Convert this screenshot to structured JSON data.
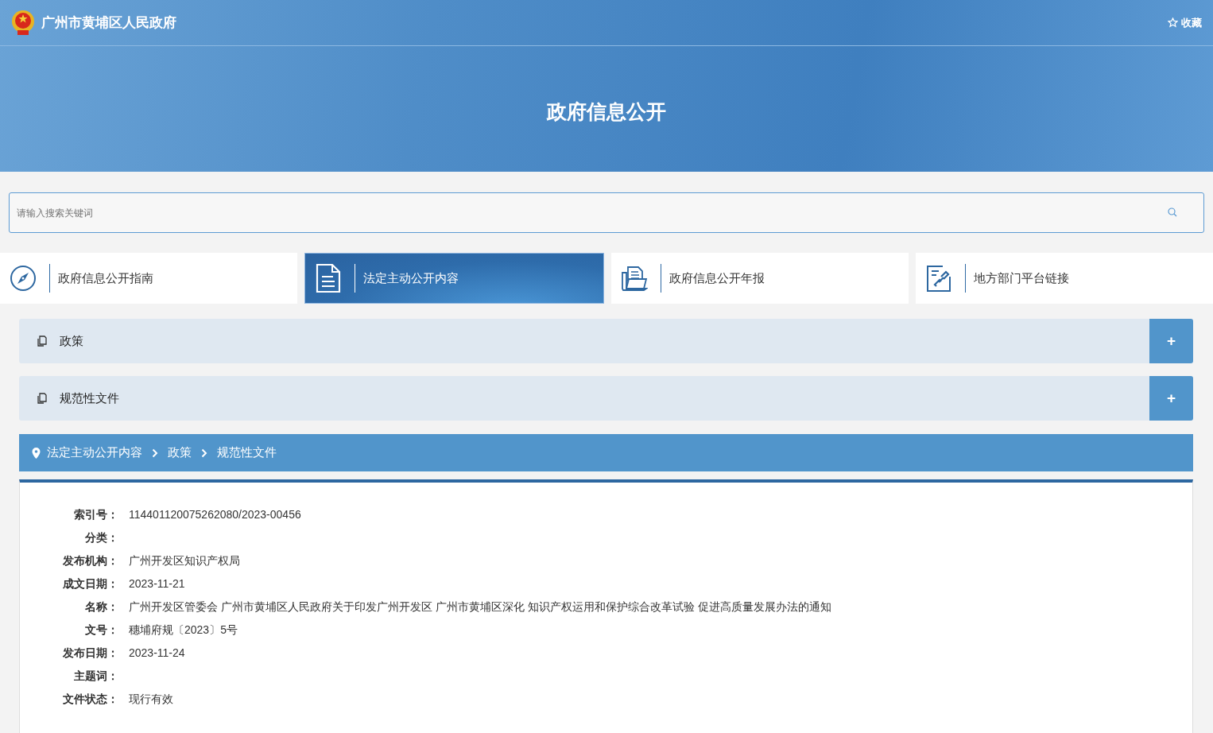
{
  "header": {
    "site_title": "广州市黄埔区人民政府",
    "favorite": "收藏",
    "banner_title": "政府信息公开"
  },
  "search": {
    "placeholder": "请输入搜索关键词"
  },
  "tabs": [
    {
      "label": "政府信息公开指南",
      "selected": false
    },
    {
      "label": "法定主动公开内容",
      "selected": true
    },
    {
      "label": "政府信息公开年报",
      "selected": false
    },
    {
      "label": "地方部门平台链接",
      "selected": false
    }
  ],
  "sections": [
    {
      "title": "政策",
      "toggle": "+"
    },
    {
      "title": "规范性文件",
      "toggle": "+"
    }
  ],
  "breadcrumb": [
    "法定主动公开内容",
    "政策",
    "规范性文件"
  ],
  "details": [
    {
      "label": "索引号：",
      "value": "114401120075262080/2023-00456"
    },
    {
      "label": "分类："
    },
    {
      "label": "发布机构：",
      "value": "广州开发区知识产权局"
    },
    {
      "label": "成文日期：",
      "value": "2023-11-21"
    },
    {
      "label": "名称：",
      "value": "广州开发区管委会 广州市黄埔区人民政府关于印发广州开发区 广州市黄埔区深化 知识产权运用和保护综合改革试验 促进高质量发展办法的通知"
    },
    {
      "label": "文号：",
      "value": "穗埔府规〔2023〕5号"
    },
    {
      "label": "发布日期：",
      "value": "2023-11-24"
    },
    {
      "label": "主题词："
    },
    {
      "label": "文件状态：",
      "value": "现行有效"
    }
  ]
}
